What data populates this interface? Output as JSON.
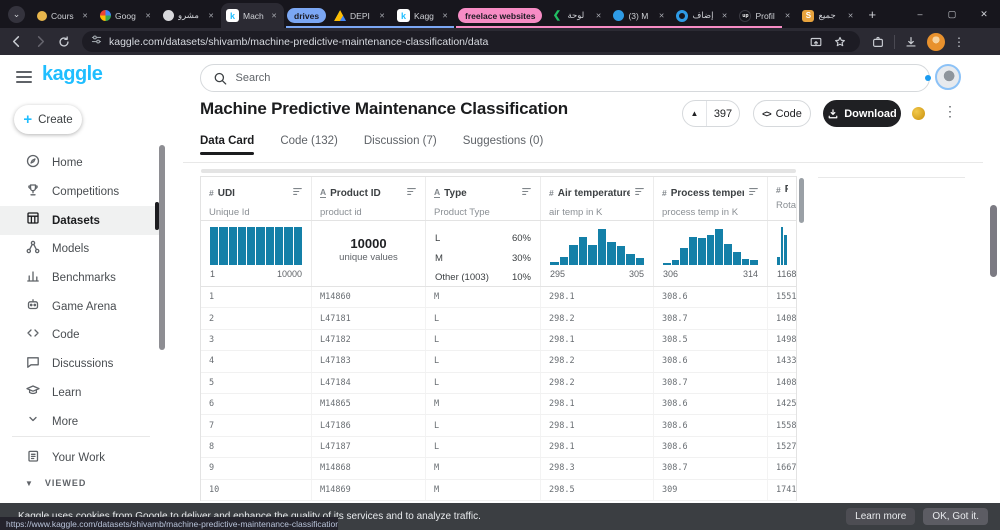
{
  "colors": {
    "accent": "#20beff",
    "histogram": "#1480a8",
    "tab_group_blue": "#7ba7f4",
    "tab_group_pink": "#f78cc5"
  },
  "browser": {
    "tabs": [
      {
        "label": "Cours",
        "icon": "coursera-icon"
      },
      {
        "label": "Goog",
        "icon": "google-icon"
      },
      {
        "label": "مشرو",
        "icon": "site-circle-icon"
      },
      {
        "label": "Mach",
        "icon": "kaggle-icon",
        "active": true
      },
      {
        "pill": "drives",
        "color": "blue"
      },
      {
        "label": "DEPI",
        "icon": "drive-icon"
      },
      {
        "label": "Kagg",
        "icon": "kaggle-icon"
      },
      {
        "pill": "freelace websites",
        "color": "pink"
      },
      {
        "label": "لوحة",
        "icon": "green-mark-icon"
      },
      {
        "label": "(3) M",
        "icon": "blue-dot-icon"
      },
      {
        "label": "إضاف",
        "icon": "blue-ring-icon"
      },
      {
        "label": "Profil",
        "icon": "upwork-icon"
      },
      {
        "label": "جميع",
        "icon": "yellow-s-icon"
      }
    ],
    "new_tab_label": "+",
    "window_controls": {
      "minimize": "–",
      "restore": "▢",
      "close": "✕"
    },
    "url": "kaggle.com/datasets/shivamb/machine-predictive-maintenance-classification/data"
  },
  "sidebar": {
    "logo": "kaggle",
    "create_label": "Create",
    "items": [
      {
        "icon": "home-icon",
        "label": "Home"
      },
      {
        "icon": "competitions-icon",
        "label": "Competitions"
      },
      {
        "icon": "datasets-icon",
        "label": "Datasets",
        "active": true
      },
      {
        "icon": "models-icon",
        "label": "Models"
      },
      {
        "icon": "benchmarks-icon",
        "label": "Benchmarks"
      },
      {
        "icon": "game-arena-icon",
        "label": "Game Arena"
      },
      {
        "icon": "code-icon",
        "label": "Code"
      },
      {
        "icon": "discussions-icon",
        "label": "Discussions"
      },
      {
        "icon": "learn-icon",
        "label": "Learn"
      },
      {
        "icon": "chevron-down-icon",
        "label": "More"
      }
    ],
    "your_work_label": "Your Work",
    "viewed_label": "VIEWED"
  },
  "search": {
    "placeholder": "Search"
  },
  "header": {
    "title": "Machine Predictive Maintenance Classification",
    "vote_count": "397",
    "code_button": "Code",
    "download_button": "Download"
  },
  "page_tabs": [
    {
      "label": "Data Card",
      "active": true
    },
    {
      "label": "Code (132)"
    },
    {
      "label": "Discussion (7)"
    },
    {
      "label": "Suggestions (0)"
    }
  ],
  "table": {
    "columns": [
      {
        "type": "numeric",
        "name": "UDI",
        "subtitle": "Unique Id",
        "summary": {
          "kind": "histogram",
          "bars": [
            1,
            1,
            1,
            1,
            1,
            1,
            1,
            1,
            1,
            1
          ],
          "min_label": "1",
          "max_label": "10000"
        }
      },
      {
        "type": "string",
        "name": "Product ID",
        "subtitle": "product id",
        "summary": {
          "kind": "unique",
          "value": "10000",
          "label": "unique values"
        }
      },
      {
        "type": "string",
        "name": "Type",
        "subtitle": "Product Type",
        "summary": {
          "kind": "categories",
          "items": [
            {
              "label": "L",
              "pct": "60%"
            },
            {
              "label": "M",
              "pct": "30%"
            },
            {
              "label": "Other (1003)",
              "pct": "10%"
            }
          ]
        }
      },
      {
        "type": "numeric",
        "name": "Air temperature [K]",
        "subtitle": "air temp in K",
        "summary": {
          "kind": "histogram",
          "bars": [
            0.07,
            0.22,
            0.52,
            0.75,
            0.52,
            0.95,
            0.6,
            0.5,
            0.28,
            0.18
          ],
          "min_label": "295",
          "max_label": "305"
        }
      },
      {
        "type": "numeric",
        "name": "Process temperat...",
        "subtitle": "process temp in K",
        "summary": {
          "kind": "histogram",
          "bars": [
            0.05,
            0.12,
            0.45,
            0.75,
            0.72,
            0.78,
            0.95,
            0.55,
            0.33,
            0.17,
            0.12
          ],
          "min_label": "306",
          "max_label": "314"
        }
      },
      {
        "type": "numeric",
        "name": "Rot",
        "subtitle": "Rotati",
        "summary": {
          "kind": "histogram",
          "bars": [
            0.22,
            1,
            0.78
          ],
          "min_label": "1168",
          "max_label": ""
        }
      }
    ],
    "rows": [
      [
        "1",
        "M14860",
        "M",
        "298.1",
        "308.6",
        "1551"
      ],
      [
        "2",
        "L47181",
        "L",
        "298.2",
        "308.7",
        "1408"
      ],
      [
        "3",
        "L47182",
        "L",
        "298.1",
        "308.5",
        "1498"
      ],
      [
        "4",
        "L47183",
        "L",
        "298.2",
        "308.6",
        "1433"
      ],
      [
        "5",
        "L47184",
        "L",
        "298.2",
        "308.7",
        "1408"
      ],
      [
        "6",
        "M14865",
        "M",
        "298.1",
        "308.6",
        "1425"
      ],
      [
        "7",
        "L47186",
        "L",
        "298.1",
        "308.6",
        "1558"
      ],
      [
        "8",
        "L47187",
        "L",
        "298.1",
        "308.6",
        "1527"
      ],
      [
        "9",
        "M14868",
        "M",
        "298.3",
        "308.7",
        "1667"
      ],
      [
        "10",
        "M14869",
        "M",
        "298.5",
        "309",
        "1741"
      ]
    ]
  },
  "cookie_banner": {
    "message": "Kaggle uses cookies from Google to deliver and enhance the quality of its services and to analyze traffic.",
    "learn_more_label": "Learn more",
    "ok_label": "OK, Got it."
  },
  "status_bar": {
    "url": "https://www.kaggle.com/datasets/shivamb/machine-predictive-maintenance-classification/data"
  }
}
